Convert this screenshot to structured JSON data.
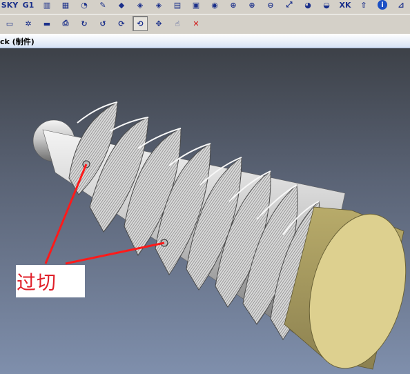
{
  "toolbar_top": {
    "buttons": [
      {
        "icon": "sky-view-icon",
        "text": "SKY"
      },
      {
        "icon": "g1-icon",
        "text": "G1"
      },
      {
        "icon": "gauge-icon",
        "text": "▥"
      },
      {
        "icon": "gauge-text-icon",
        "text": "▦"
      },
      {
        "icon": "lathe-icon",
        "text": "◔"
      },
      {
        "icon": "pen-icon",
        "text": "✎"
      },
      {
        "icon": "eraser-icon",
        "text": "◆"
      },
      {
        "icon": "pencil-eraser-icon",
        "text": "◈"
      },
      {
        "icon": "pencil-eraser-2-icon",
        "text": "◈"
      },
      {
        "icon": "book-icon",
        "text": "▤"
      },
      {
        "icon": "folder-icon",
        "text": "▣"
      },
      {
        "icon": "palette-icon",
        "text": "◉"
      },
      {
        "icon": "zoom-window-icon",
        "text": "⊕"
      },
      {
        "icon": "zoom-in-icon",
        "text": "⊕"
      },
      {
        "icon": "zoom-out-icon",
        "text": "⊖"
      },
      {
        "icon": "fit-view-icon",
        "text": "⤢"
      },
      {
        "icon": "eye-icon",
        "text": "◕"
      },
      {
        "icon": "grab-icon",
        "text": "◒"
      },
      {
        "icon": "xk-icon",
        "text": "XK"
      },
      {
        "icon": "export-icon",
        "text": "⇧"
      },
      {
        "icon": "info-icon",
        "text": "i"
      },
      {
        "icon": "chart-icon",
        "text": "⊿"
      }
    ]
  },
  "toolbar_bottom": {
    "buttons": [
      {
        "icon": "camera-icon",
        "text": "▭"
      },
      {
        "icon": "settings-icon",
        "text": "✲"
      },
      {
        "icon": "image-icon",
        "text": "▬"
      },
      {
        "icon": "print-icon",
        "text": "⎙"
      },
      {
        "icon": "rotate-x-icon",
        "text": "↻"
      },
      {
        "icon": "rotate-y-icon",
        "text": "↺"
      },
      {
        "icon": "rotate-z-icon",
        "text": "⟳"
      },
      {
        "icon": "rotate-xy-icon",
        "text": "⟲"
      },
      {
        "icon": "move-icon",
        "text": "✥"
      },
      {
        "icon": "pointer-icon",
        "text": "☝"
      },
      {
        "icon": "close-icon",
        "text": "✕"
      }
    ]
  },
  "window": {
    "title": "ck (制件)"
  },
  "viewport": {
    "callout_text": "过切"
  },
  "colors": {
    "toolbar_bg": "#d4d0c8",
    "callout_text": "#e0202a",
    "callout_line": "#ff1a1a",
    "cap_fill": "#d8c98a",
    "thread_light": "#e8e8e8",
    "viewport_top": "#3d4148",
    "viewport_bottom": "#7f8fac"
  }
}
